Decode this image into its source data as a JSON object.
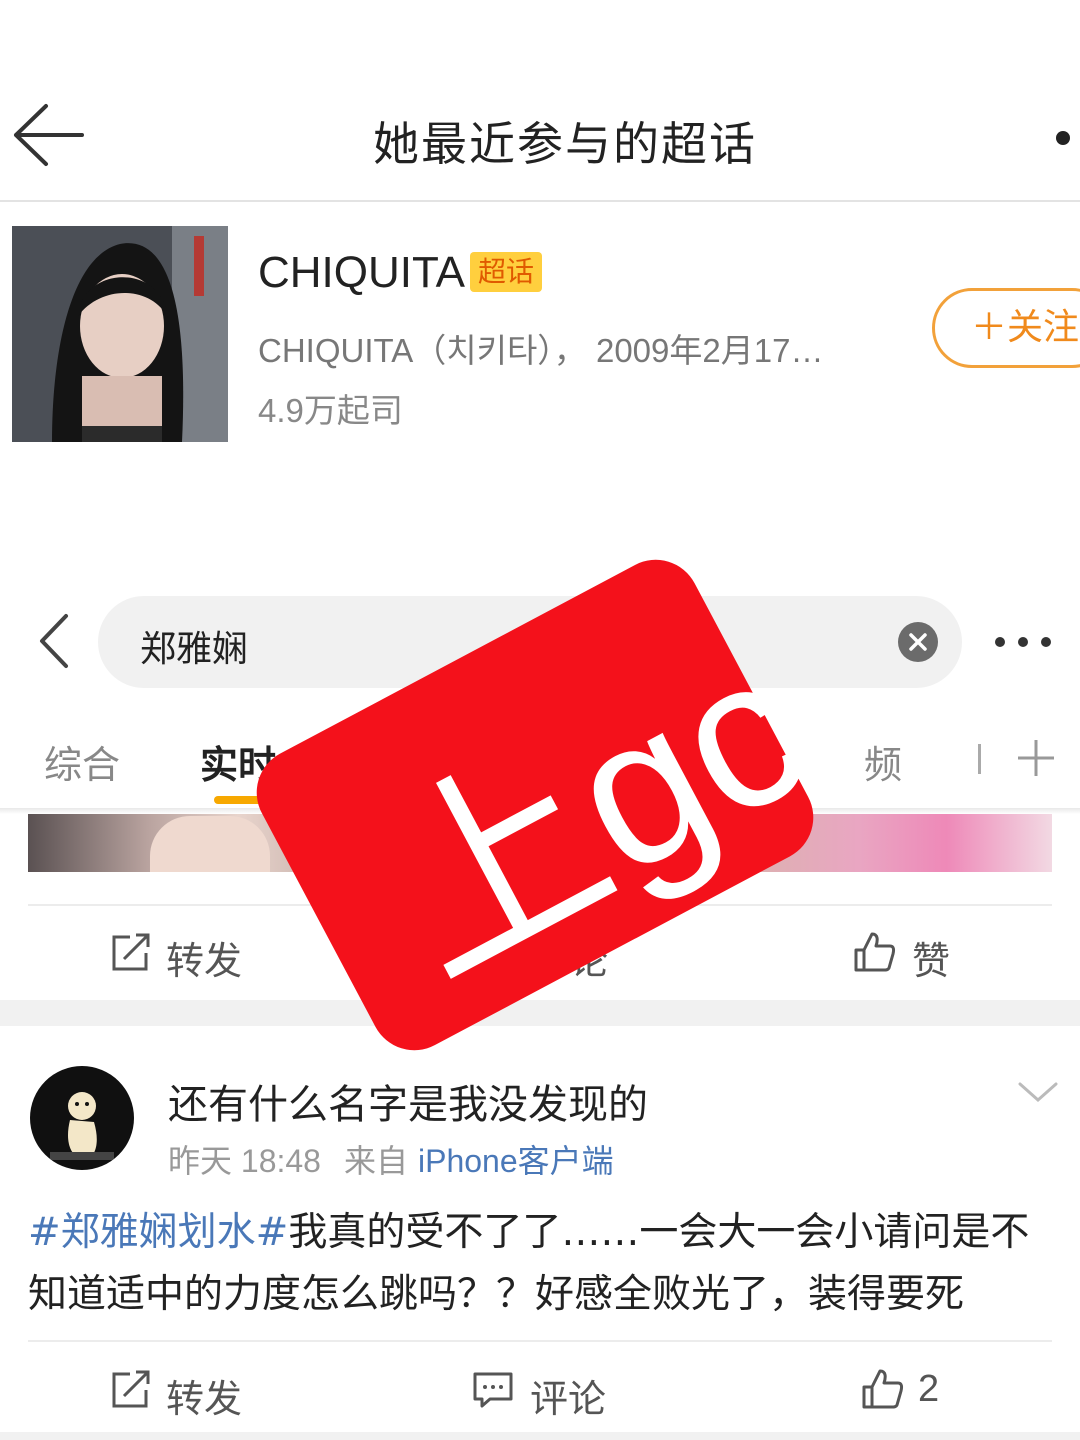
{
  "header": {
    "title": "她最近参与的超话"
  },
  "topic": {
    "name": "CHIQUITA",
    "badge": "超话",
    "description": "CHIQUITA（치키타）， 2009年2月17…",
    "followers": "4.9万起司",
    "follow_label": "＋关注"
  },
  "search": {
    "query": "郑雅娴"
  },
  "tabs": [
    {
      "label": "综合"
    },
    {
      "label": "实时",
      "active": true
    },
    {
      "label": "频"
    }
  ],
  "post_prev": {
    "repost_label": "转发",
    "comment_label": "论",
    "like_label": "赞"
  },
  "post": {
    "title": "还有什么名字是我没发现的",
    "time": "昨天 18:48",
    "from": "来自",
    "client": "iPhone客户端",
    "tag": "#郑雅娴划水#",
    "body": "我真的受不了了……一会大一会小请问是不知道适中的力度怎么跳吗？？好感全败光了，装得要死",
    "repost_label": "转发",
    "comment_label": "评论",
    "like_count": "2"
  },
  "stamp": {
    "text": "上gc",
    "color": "#f4111b"
  },
  "colors": {
    "accent": "#f7a800",
    "link": "#4a78b8",
    "follow": "#f08a1c"
  }
}
